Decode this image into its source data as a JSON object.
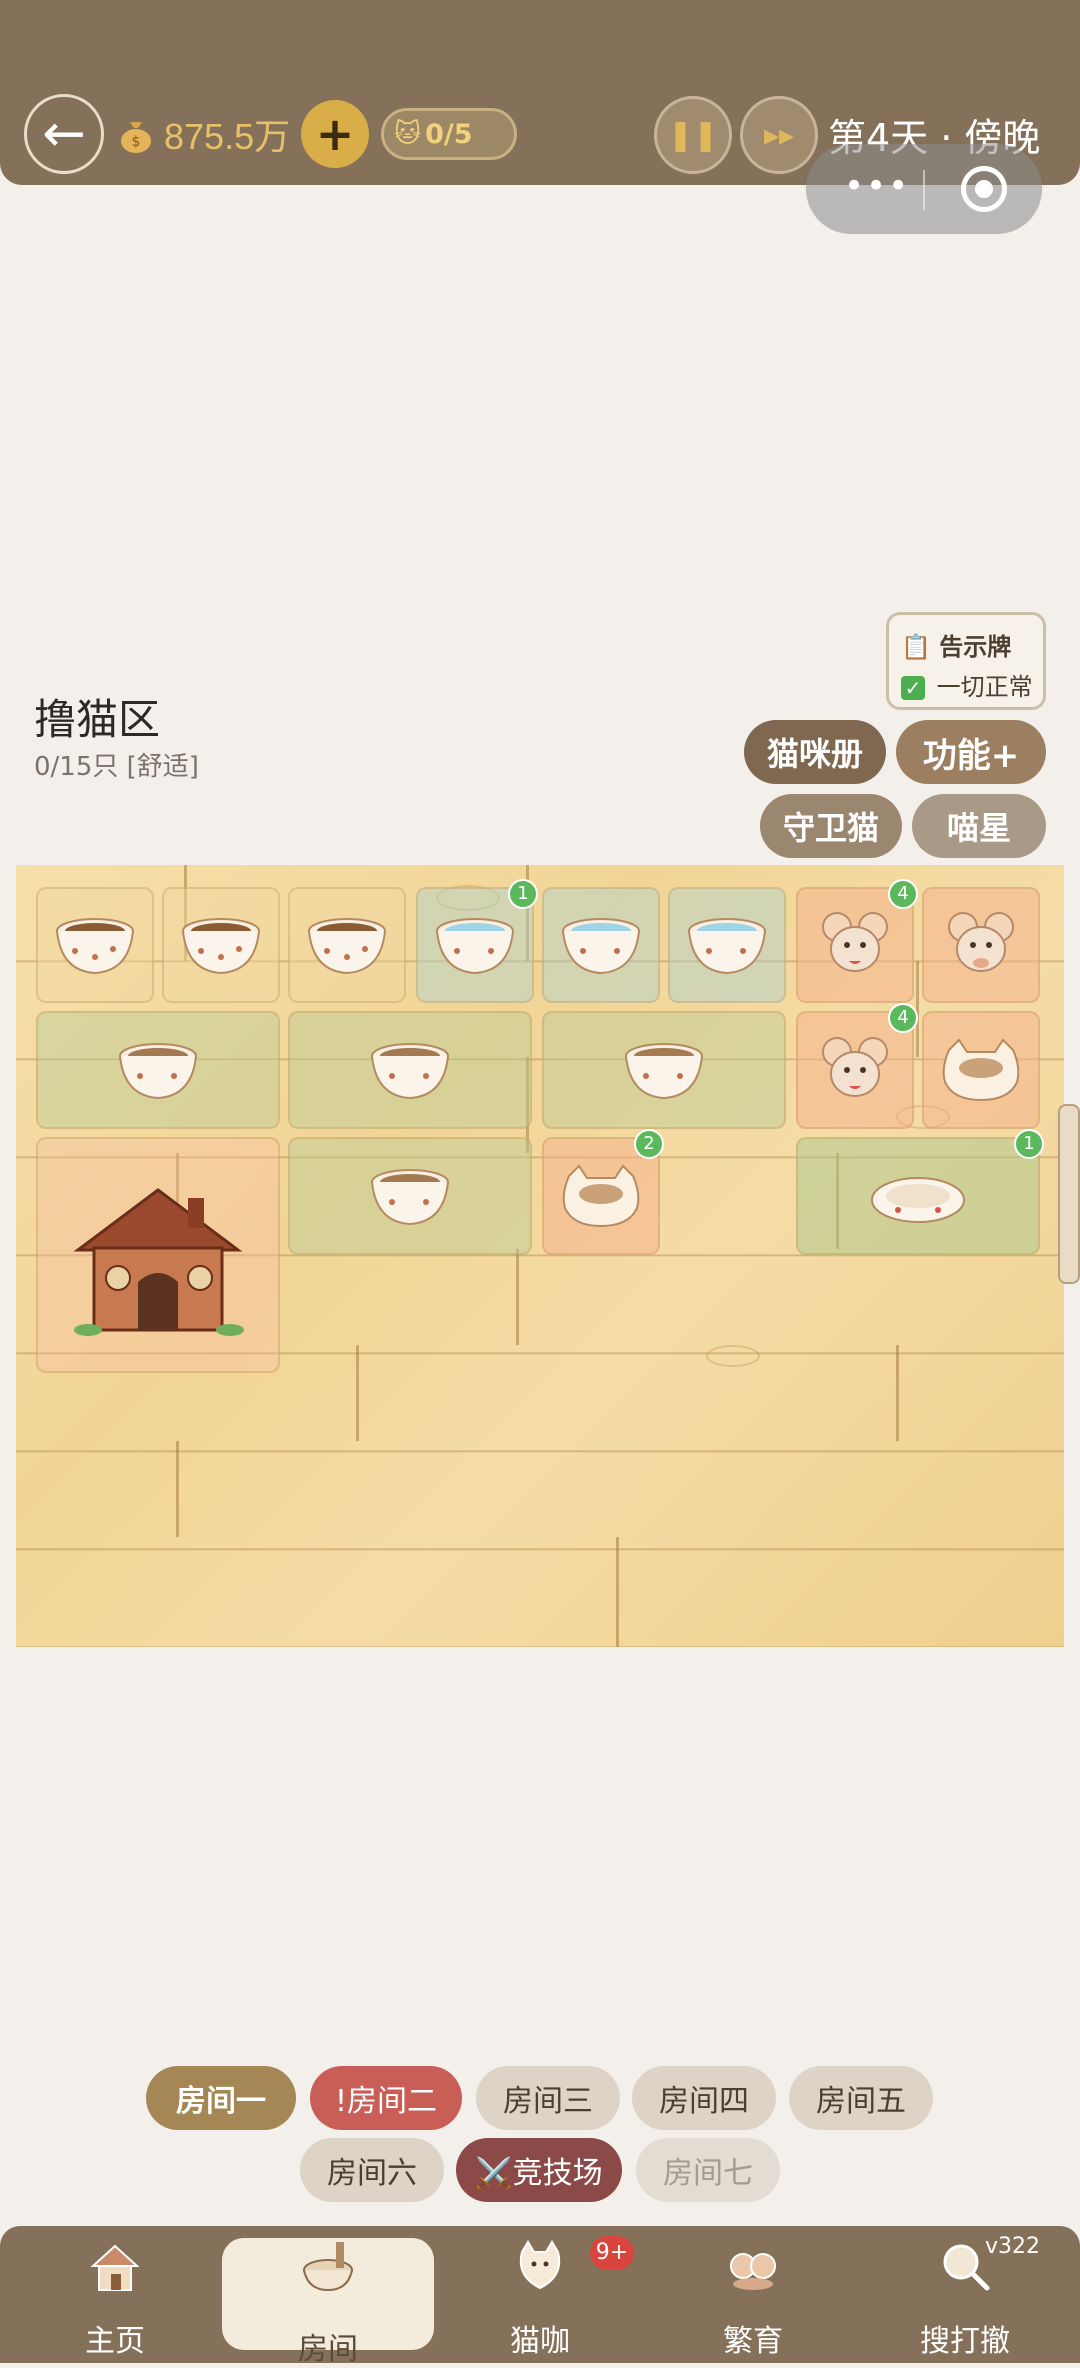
{
  "header": {
    "back_icon": "back-arrow-icon",
    "money": "875.5万",
    "cat_count": "0/5",
    "pause_icon": "pause-icon",
    "fast_forward_icon": "fast-forward-icon",
    "day_time": "第4天 · 傍晚",
    "menu_dots": "•••"
  },
  "notice_board": {
    "title": "告示牌",
    "status": "一切正常"
  },
  "zone": {
    "title": "撸猫区",
    "subtitle": "0/15只 [舒适]"
  },
  "action_buttons": {
    "cat_book": "猫咪册",
    "features": "功能+",
    "guard_cat": "守卫猫",
    "meow_star": "喵星"
  },
  "floor_items": {
    "water_badge": "1",
    "toy_badge_top": "4",
    "toy_badge_mid": "4",
    "bowl_badge": "2",
    "bed_badge": "1"
  },
  "rooms": {
    "tabs": [
      "房间一",
      "!房间二",
      "房间三",
      "房间四",
      "房间五",
      "房间六",
      "⚔️竞技场",
      "房间七"
    ]
  },
  "bottom_nav": {
    "items": [
      "主页",
      "房间",
      "猫咖",
      "繁育",
      "搜打撤"
    ],
    "badge": "9+",
    "version": "v322"
  },
  "colors": {
    "topbar": "#85715a",
    "gold": "#e7c067",
    "active_tab": "#a48755",
    "alert_tab": "#c85e55",
    "arena_tab": "#8b4a47",
    "badge_green": "#5cb85c"
  }
}
